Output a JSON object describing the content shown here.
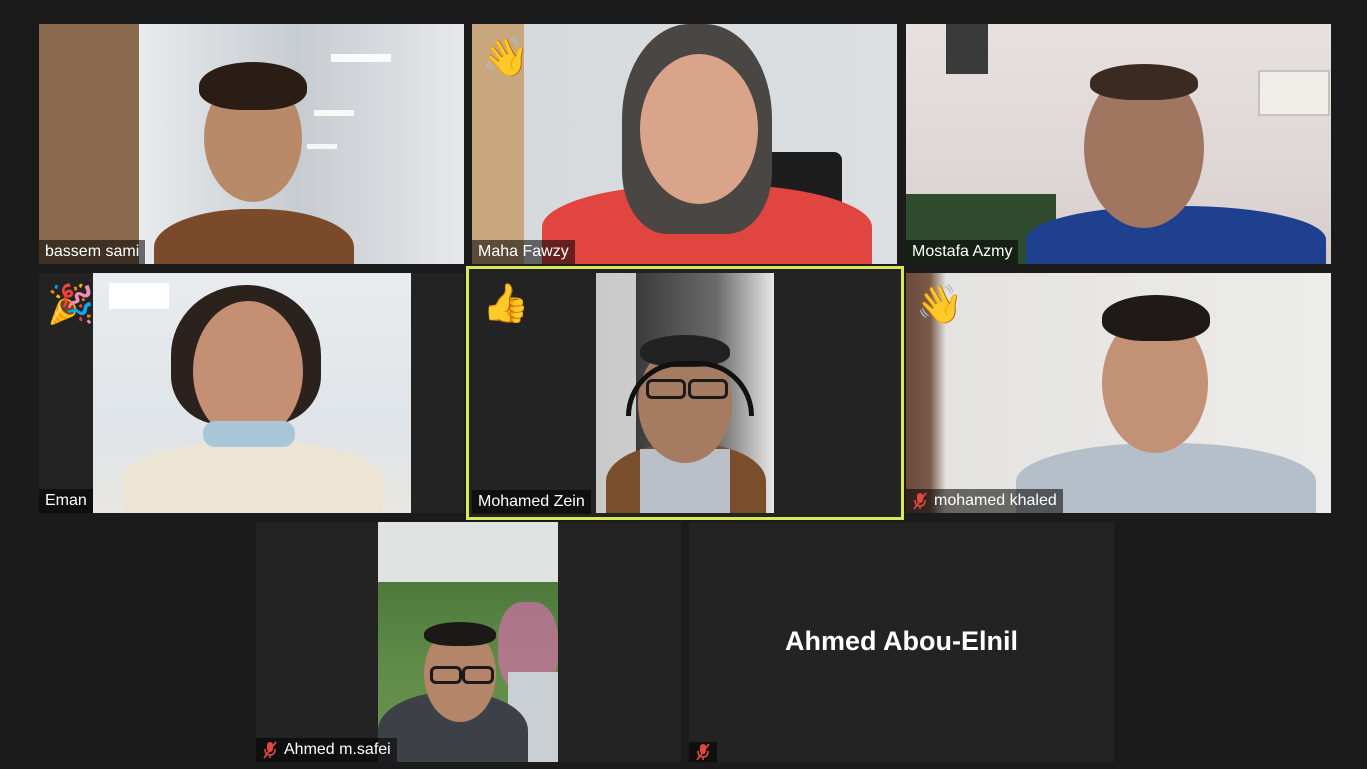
{
  "participants": [
    {
      "name": "bassem sami",
      "muted": false,
      "reaction": ""
    },
    {
      "name": "Maha Fawzy",
      "muted": false,
      "reaction": "👋"
    },
    {
      "name": "Mostafa Azmy",
      "muted": false,
      "reaction": ""
    },
    {
      "name": "Eman",
      "muted": false,
      "reaction": "🎉"
    },
    {
      "name": "Mohamed Zein",
      "muted": false,
      "reaction": "👍",
      "active_speaker": true
    },
    {
      "name": "mohamed khaled",
      "muted": true,
      "reaction": "👋"
    },
    {
      "name": "Ahmed m.safei",
      "muted": true,
      "reaction": ""
    },
    {
      "name": "Ahmed Abou-Elnil",
      "muted": true,
      "reaction": "",
      "video": "off"
    }
  ],
  "colors": {
    "background": "#1b1b1b",
    "tile": "#232323",
    "active_speaker_border": "#d9e85a",
    "muted_icon": "#e0473f"
  },
  "icons": {
    "muted": "mic-off-icon"
  }
}
